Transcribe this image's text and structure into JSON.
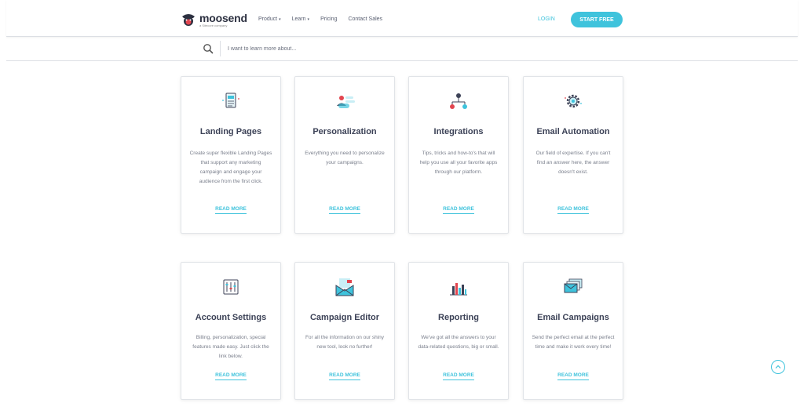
{
  "brand": {
    "name": "moosend",
    "tagline": "a Sitecore company"
  },
  "nav": {
    "items": [
      {
        "label": "Product",
        "caret": "▾"
      },
      {
        "label": "Learn",
        "caret": "▾"
      },
      {
        "label": "Pricing",
        "caret": ""
      },
      {
        "label": "Contact Sales",
        "caret": ""
      }
    ]
  },
  "header": {
    "login_label": "LOGIN",
    "start_label": "START FREE"
  },
  "search": {
    "placeholder": "I want to learn more about..."
  },
  "cards": [
    {
      "title": "Landing Pages",
      "description": "Create super flexible Landing Pages that support any marketing campaign and engage your audience from the first click.",
      "link": "READ MORE"
    },
    {
      "title": "Personalization",
      "description": "Everything you need to personalize your campaigns.",
      "link": "READ MORE"
    },
    {
      "title": "Integrations",
      "description": "Tips, tricks and how-to's that will help you use all your favorite apps through our platform.",
      "link": "READ MORE"
    },
    {
      "title": "Email Automation",
      "description": "Our field of expertise. If you can't find an answer here, the answer doesn't exist.",
      "link": "READ MORE"
    },
    {
      "title": "Account Settings",
      "description": "Billing, personalization, special features made easy. Just click the link below.",
      "link": "READ MORE"
    },
    {
      "title": "Campaign Editor",
      "description": "For all the information on our shiny new tool, look no further!",
      "link": "READ MORE"
    },
    {
      "title": "Reporting",
      "description": "We've got all the answers to your data-related questions, big or small.",
      "link": "READ MORE"
    },
    {
      "title": "Email Campaigns",
      "description": "Send the perfect email at the perfect time and make it work every time!",
      "link": "READ MORE"
    }
  ],
  "colors": {
    "accent": "#3fc3dc",
    "text": "#3c4257",
    "muted": "#7a7f8c"
  }
}
